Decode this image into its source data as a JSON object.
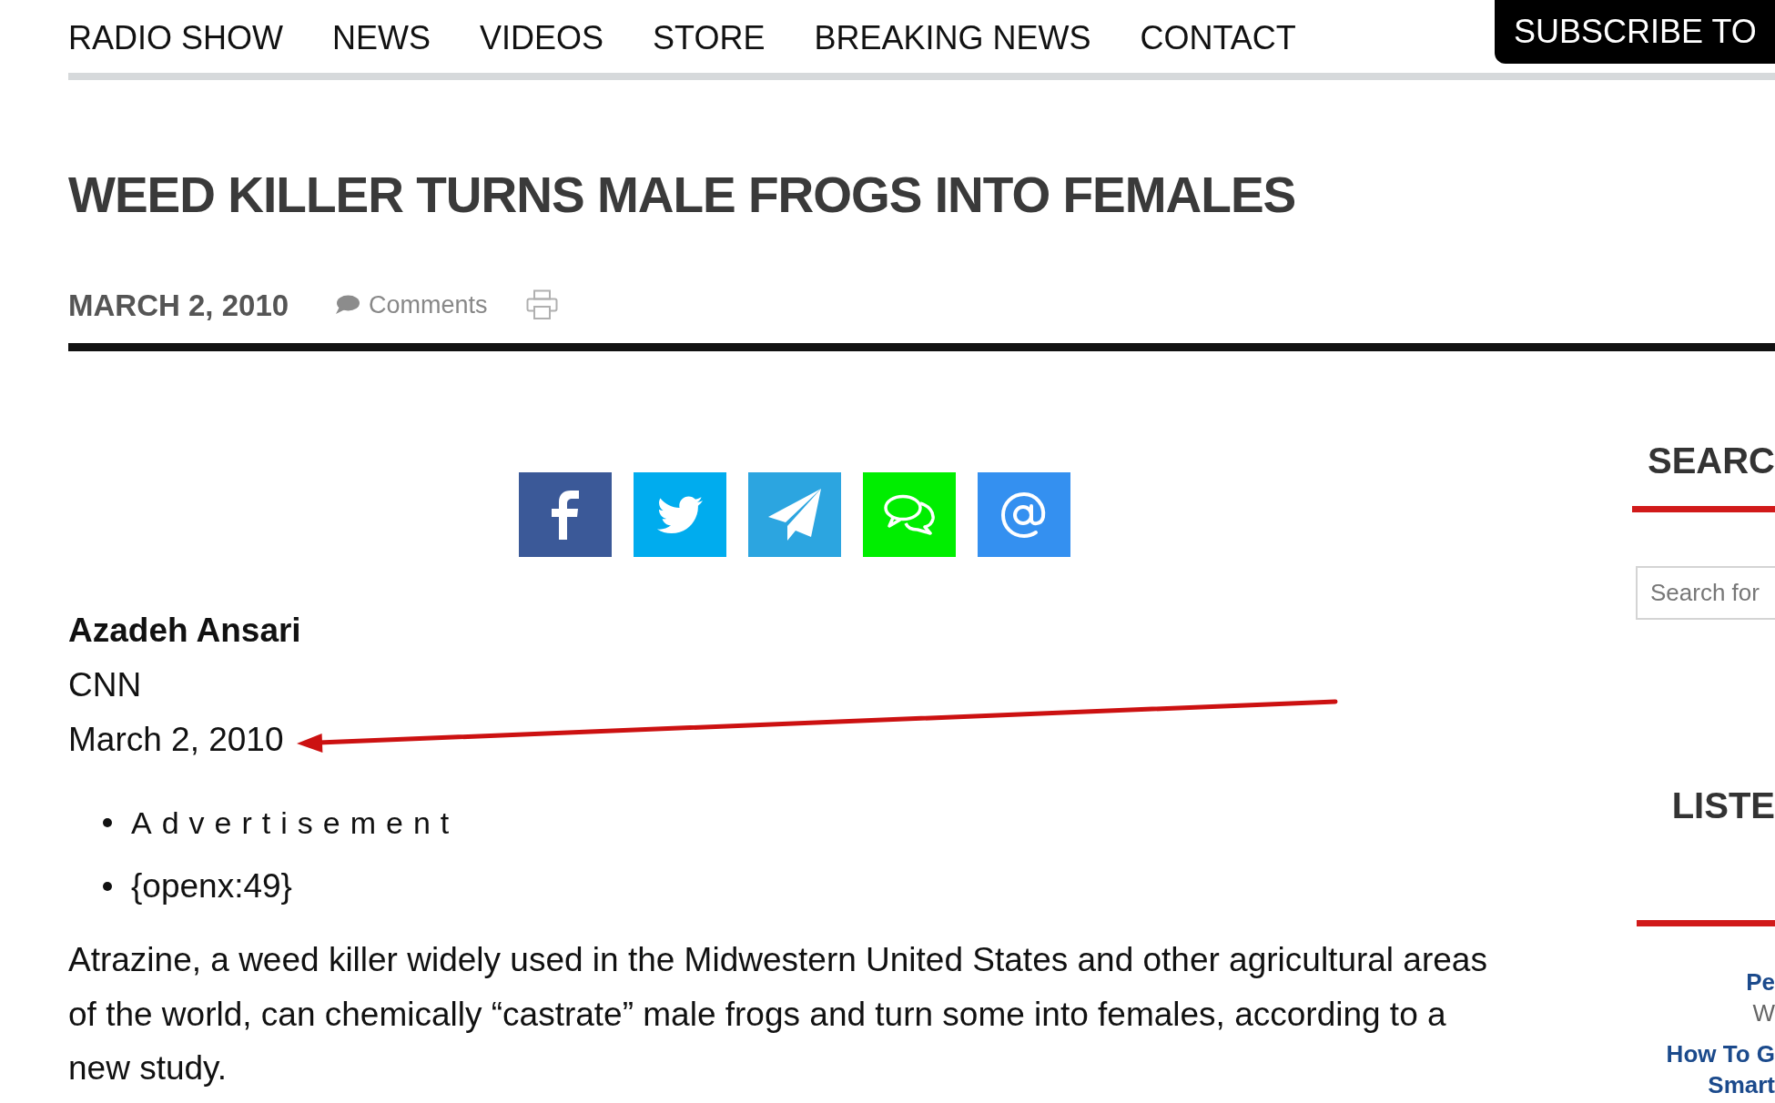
{
  "nav": {
    "links": [
      "RADIO SHOW",
      "NEWS",
      "VIDEOS",
      "STORE",
      "BREAKING NEWS",
      "CONTACT"
    ],
    "subscribe_button": "SUBSCRIBE TO"
  },
  "article": {
    "title": "WEED KILLER TURNS MALE FROGS INTO FEMALES",
    "date": "MARCH 2, 2010",
    "comments_link": "Comments",
    "share_buttons": [
      {
        "kind": "facebook"
      },
      {
        "kind": "twitter"
      },
      {
        "kind": "telegram"
      },
      {
        "kind": "chat"
      },
      {
        "kind": "email"
      }
    ],
    "byline": {
      "author": "Azadeh Ansari",
      "source": "CNN",
      "date": "March 2, 2010"
    },
    "list_items": [
      "Advertisement",
      "{openx:49}"
    ],
    "paragraph": "Atrazine, a weed killer widely used in the Midwestern United States and other agricultural areas of the world, can chemically “castrate” male frogs and turn some into females, according to a new study."
  },
  "sidebar": {
    "search_heading": "SEARC",
    "search_field": {
      "placeholder": "Search for"
    },
    "listen_heading": "LISTE",
    "lines": [
      {
        "text": "Pe",
        "kind": "link"
      },
      {
        "text": "W",
        "kind": "text"
      },
      {
        "text": "How To G",
        "kind": "link"
      },
      {
        "text": "Smart",
        "kind": "link"
      }
    ]
  }
}
